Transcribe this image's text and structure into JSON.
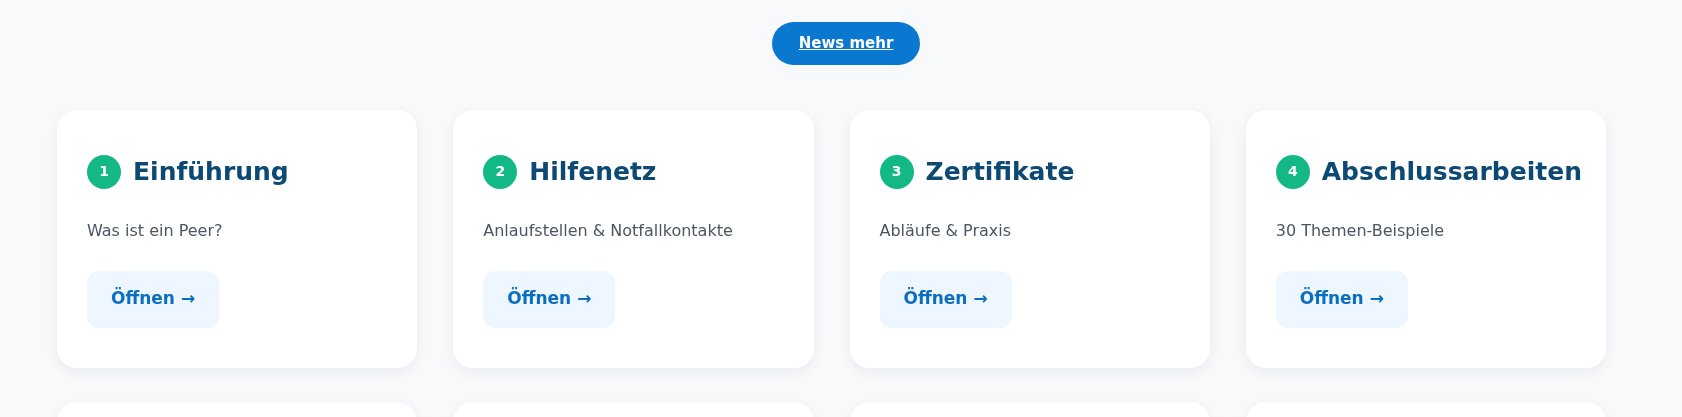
{
  "news_button": {
    "label": "News mehr"
  },
  "cards": [
    {
      "number": "1",
      "title": "Einführung",
      "subtitle": "Was ist ein Peer?",
      "button": "Öffnen →"
    },
    {
      "number": "2",
      "title": "Hilfenetz",
      "subtitle": "Anlaufstellen & Notfallkontakte",
      "button": "Öffnen →"
    },
    {
      "number": "3",
      "title": "Zertifikate",
      "subtitle": "Abläufe & Praxis",
      "button": "Öffnen →"
    },
    {
      "number": "4",
      "title": "Abschlussarbeiten",
      "subtitle": "30 Themen-Beispiele",
      "button": "Öffnen →"
    }
  ],
  "next_row_cards": [
    {
      "kind": "card"
    },
    {
      "kind": "card"
    },
    {
      "kind": "card"
    },
    {
      "kind": "card"
    }
  ]
}
